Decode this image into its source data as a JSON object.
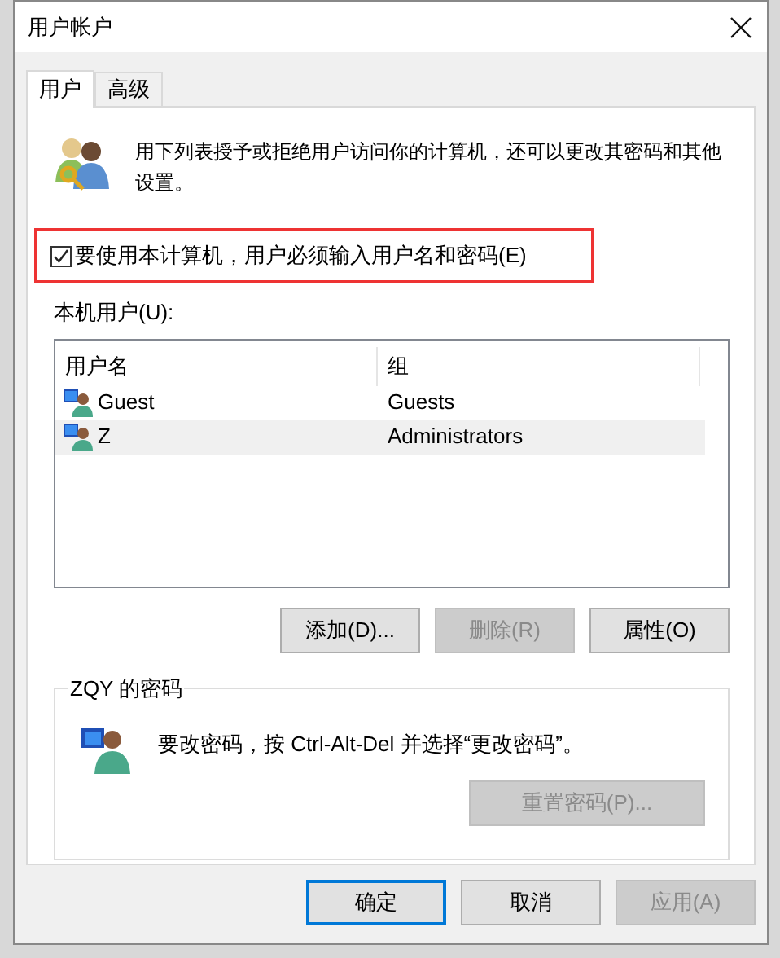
{
  "window": {
    "title": "用户帐户"
  },
  "tabs": [
    {
      "label": "用户",
      "selected": true
    },
    {
      "label": "高级",
      "selected": false
    }
  ],
  "intro": "用下列表授予或拒绝用户访问你的计算机，还可以更改其密码和其他设置。",
  "require_password": {
    "label": "要使用本计算机，用户必须输入用户名和密码(E)",
    "checked": true,
    "highlighted": true
  },
  "users_label": "本机用户(U):",
  "table": {
    "columns": [
      "用户名",
      "组"
    ],
    "rows": [
      {
        "name": "Guest",
        "group": "Guests",
        "selected": false
      },
      {
        "name": "Z",
        "group": "Administrators",
        "selected": true
      }
    ]
  },
  "list_buttons": [
    {
      "label": "添加(D)...",
      "disabled": false
    },
    {
      "label": "删除(R)",
      "disabled": true
    },
    {
      "label": "属性(O)",
      "disabled": false
    }
  ],
  "password_group": {
    "title": "ZQY 的密码",
    "text": "要改密码，按 Ctrl-Alt-Del 并选择“更改密码”。",
    "button": {
      "label": "重置密码(P)...",
      "disabled": true
    }
  },
  "dialog_buttons": [
    {
      "label": "确定",
      "default": true,
      "disabled": false
    },
    {
      "label": "取消",
      "default": false,
      "disabled": false
    },
    {
      "label": "应用(A)",
      "default": false,
      "disabled": true
    }
  ]
}
